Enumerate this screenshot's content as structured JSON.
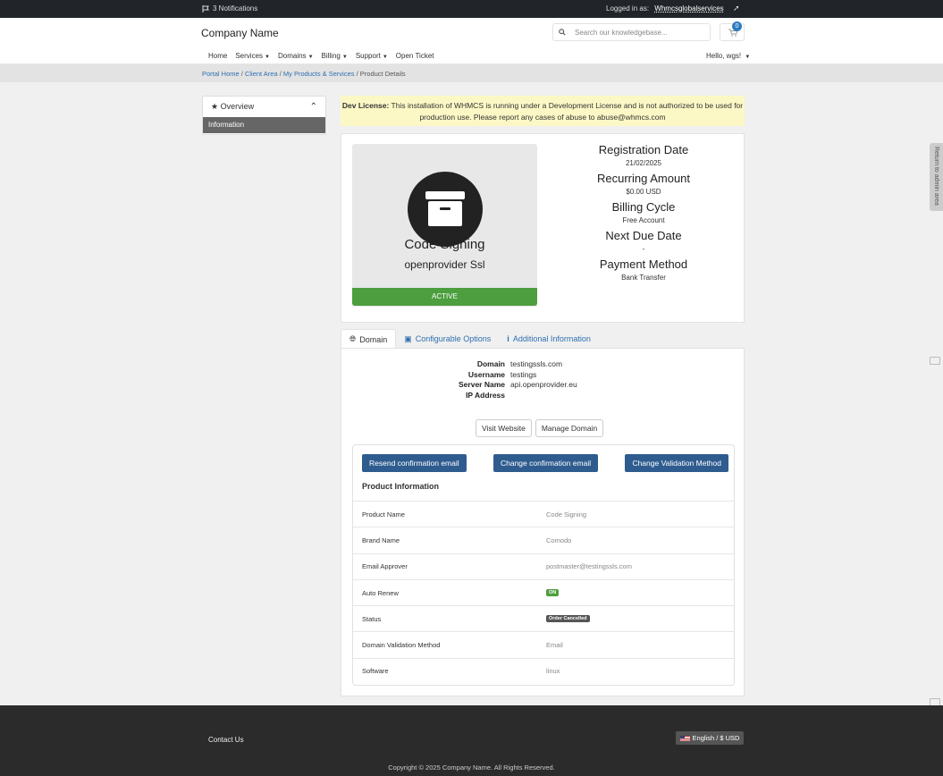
{
  "topbar": {
    "notifications": "3 Notifications",
    "logged_in_label": "Logged in as:",
    "username": "Whmcsglobalservices"
  },
  "header": {
    "brand": "Company Name",
    "search_placeholder": "Search our knowledgebase...",
    "cart_count": "0"
  },
  "nav": {
    "items": [
      "Home",
      "Services",
      "Domains",
      "Billing",
      "Support",
      "Open Ticket"
    ],
    "greeting": "Hello, wgs!"
  },
  "breadcrumb": {
    "items": [
      "Portal Home",
      "Client Area",
      "My Products & Services"
    ],
    "current": "Product Details"
  },
  "sidebar": {
    "title": "Overview",
    "items": [
      "Information"
    ]
  },
  "license": {
    "bold": "Dev License:",
    "text": "This installation of WHMCS is running under a Development License and is not authorized to be used for production use. Please report any cases of abuse to abuse@whmcs.com"
  },
  "product": {
    "name": "Code Signing",
    "group": "openprovider Ssl",
    "status": "ACTIVE",
    "details": [
      {
        "label": "Registration Date",
        "value": "21/02/2025"
      },
      {
        "label": "Recurring Amount",
        "value": "$0.00 USD"
      },
      {
        "label": "Billing Cycle",
        "value": "Free Account"
      },
      {
        "label": "Next Due Date",
        "value": "-"
      },
      {
        "label": "Payment Method",
        "value": "Bank Transfer"
      }
    ]
  },
  "tabs": [
    "Domain",
    "Configurable Options",
    "Additional Information"
  ],
  "domain_info": [
    {
      "k": "Domain",
      "v": "testingssls.com"
    },
    {
      "k": "Username",
      "v": "testings"
    },
    {
      "k": "Server Name",
      "v": "api.openprovider.eu"
    },
    {
      "k": "IP Address",
      "v": ""
    }
  ],
  "domain_buttons": [
    "Visit Website",
    "Manage Domain"
  ],
  "ssl_actions": [
    "Resend confirmation email",
    "Change confirmation email",
    "Change Validation Method"
  ],
  "product_info": {
    "title": "Product Information",
    "rows": [
      {
        "k": "Product Name",
        "v": "Code Signing"
      },
      {
        "k": "Brand Name",
        "v": "Comodo"
      },
      {
        "k": "Email Approver",
        "v": "postmaster@testingssls.com"
      },
      {
        "k": "Auto Renew",
        "v": "ON",
        "pill": "#4d9e3f"
      },
      {
        "k": "Status",
        "v": "Order Cancelled",
        "pill": "#555555"
      },
      {
        "k": "Domain Validation Method",
        "v": "Email"
      },
      {
        "k": "Software",
        "v": "linux"
      }
    ]
  },
  "return_admin": "Return to admin area",
  "footer": {
    "contact": "Contact Us",
    "language": "English / $ USD",
    "copyright": "Copyright © 2025 Company Name. All Rights Reserved."
  }
}
